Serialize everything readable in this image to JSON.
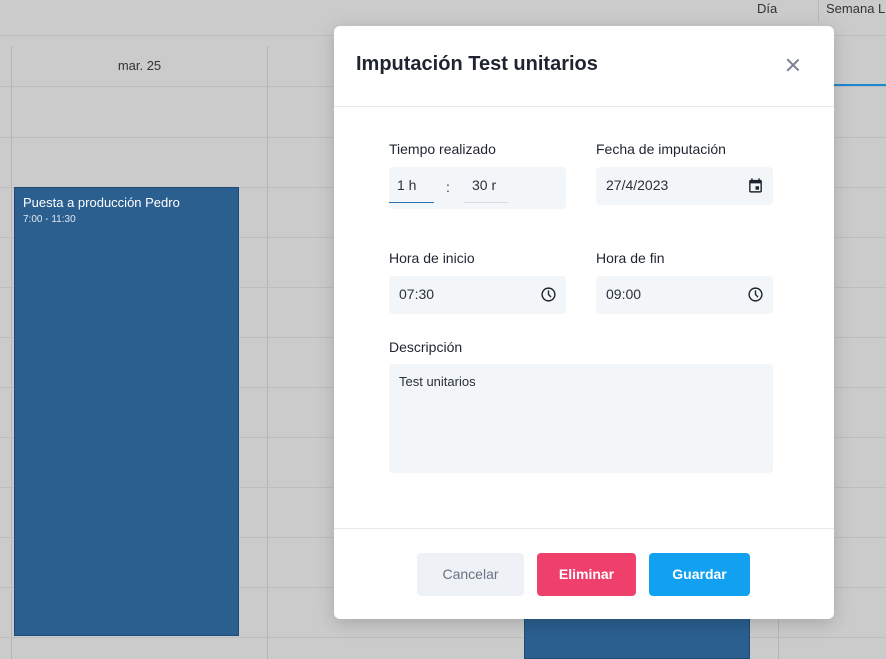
{
  "calendar": {
    "view_tabs": {
      "day": "Día",
      "week": "Semana L"
    },
    "day_header": "mar. 25",
    "event": {
      "title": "Puesta a producción Pedro",
      "time": "7:00 - 11:30"
    }
  },
  "modal": {
    "title": "Imputación Test unitarios",
    "time_spent": {
      "label": "Tiempo realizado",
      "hours": "1 h",
      "separator": ":",
      "minutes": "30 r"
    },
    "date": {
      "label": "Fecha de imputación",
      "value": "27/4/2023"
    },
    "start": {
      "label": "Hora de inicio",
      "value": "07:30"
    },
    "end": {
      "label": "Hora de fin",
      "value": "09:00"
    },
    "description": {
      "label": "Descripción",
      "value": "Test unitarios"
    },
    "buttons": {
      "cancel": "Cancelar",
      "delete": "Eliminar",
      "save": "Guardar"
    }
  },
  "colors": {
    "event": "#2a5f8f",
    "delete": "#ef3f6b",
    "save": "#12a1f1",
    "active_tab": "#1c88d4"
  },
  "icons": [
    "calendar-icon",
    "clock-icon",
    "close-icon"
  ]
}
